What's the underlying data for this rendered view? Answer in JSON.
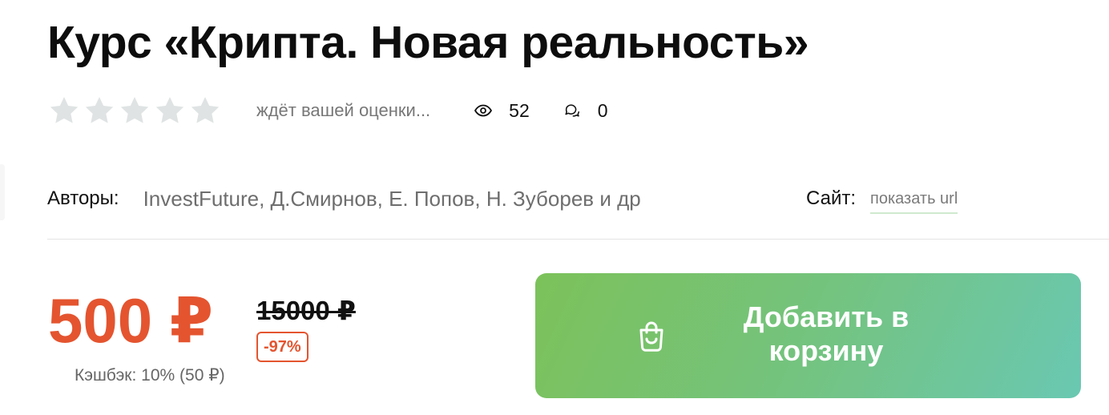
{
  "product": {
    "title": "Курс «Крипта. Новая реальность»",
    "rating": {
      "stars": 5,
      "filled": 0,
      "text": "ждёт вашей оценки..."
    },
    "views": "52",
    "comments": "0",
    "authors_label": "Авторы:",
    "authors": "InvestFuture, Д.Смирнов, Е. Попов, Н. Зуборев и др",
    "site_label": "Сайт:",
    "site_link": "показать url"
  },
  "pricing": {
    "price": "500 ₽",
    "old_price": "15000 ₽",
    "discount": "-97%",
    "cashback": "Кэшбэк: 10% (50 ₽)"
  },
  "cart": {
    "label": "Добавить в корзину"
  },
  "colors": {
    "accent_price": "#e4542f",
    "star_empty": "#dfe3e3",
    "button_gradient_start": "#7cc25a",
    "button_gradient_end": "#6ac8b2"
  },
  "icons": {
    "star": "star-icon",
    "views": "eye-icon",
    "comments": "comment-bubbles-icon",
    "cart": "shopping-bag-icon"
  }
}
